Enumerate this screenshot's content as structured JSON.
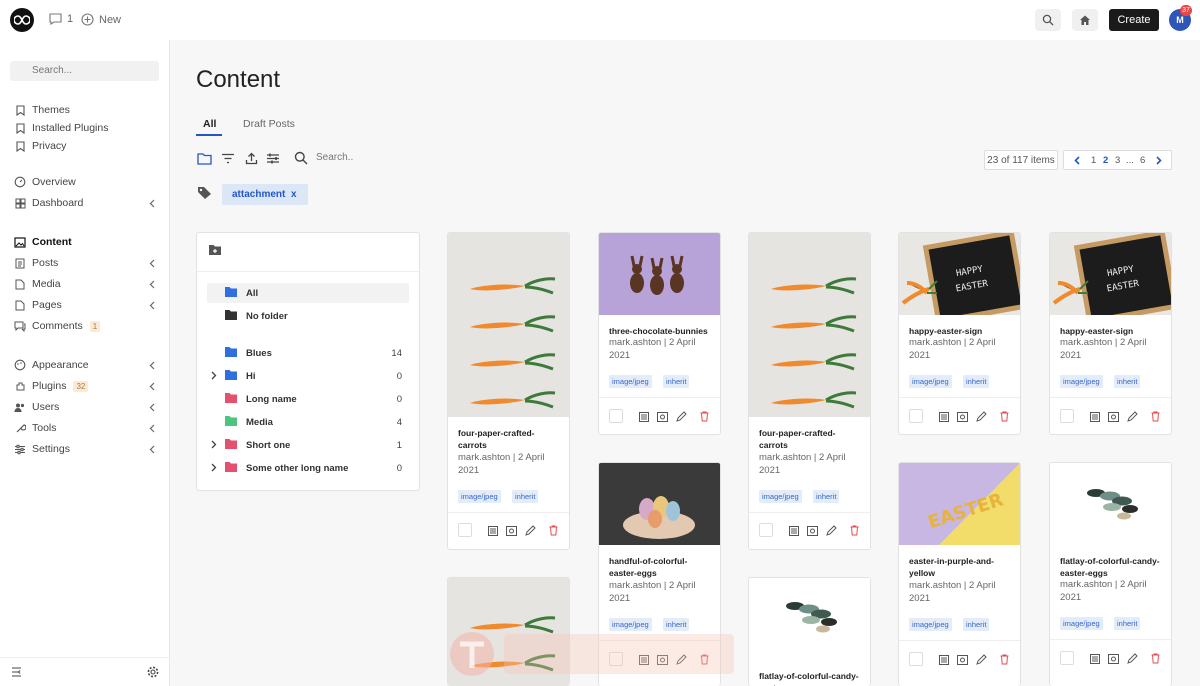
{
  "header": {
    "comments_count": "1",
    "new_label": "New",
    "create_label": "Create",
    "avatar_initial": "M",
    "avatar_badge": "37"
  },
  "sidebar": {
    "search_placeholder": "Search...",
    "items": [
      {
        "label": "Themes"
      },
      {
        "label": "Installed Plugins"
      },
      {
        "label": "Privacy"
      },
      {
        "label": "Overview"
      },
      {
        "label": "Dashboard"
      },
      {
        "label": "Content"
      },
      {
        "label": "Posts"
      },
      {
        "label": "Media"
      },
      {
        "label": "Pages"
      },
      {
        "label": "Comments",
        "badge": "1"
      },
      {
        "label": "Appearance"
      },
      {
        "label": "Plugins",
        "badge": "32"
      },
      {
        "label": "Users"
      },
      {
        "label": "Tools"
      },
      {
        "label": "Settings"
      }
    ]
  },
  "main": {
    "title": "Content",
    "tabs": [
      {
        "label": "All"
      },
      {
        "label": "Draft Posts"
      }
    ],
    "search_placeholder": "Search..",
    "items_count": "23 of 117 items",
    "pagination": [
      "1",
      "2",
      "3",
      "...",
      "6"
    ],
    "filter_tag": "attachment",
    "filter_remove": "x"
  },
  "folders": [
    {
      "name": "All",
      "count": ""
    },
    {
      "name": "No folder",
      "count": ""
    },
    {
      "name": "Blues",
      "count": "14"
    },
    {
      "name": "Hi",
      "count": "0"
    },
    {
      "name": "Long name",
      "count": "0"
    },
    {
      "name": "Media",
      "count": "4"
    },
    {
      "name": "Short one",
      "count": "1"
    },
    {
      "name": "Some other long name",
      "count": "0"
    }
  ],
  "cards": [
    {
      "name": "four-paper-crafted-carrots",
      "meta": "mark.ashton | 2 April 2021",
      "type": "image/jpeg",
      "status": "inherit"
    },
    {
      "name": "three-chocolate-bunnies",
      "meta": "mark.ashton | 2 April 2021",
      "type": "image/jpeg",
      "status": "inherit"
    },
    {
      "name": "four-paper-crafted-carrots",
      "meta": "mark.ashton | 2 April 2021",
      "type": "image/jpeg",
      "status": "inherit"
    },
    {
      "name": "happy-easter-sign",
      "meta": "mark.ashton | 2 April 2021",
      "type": "image/jpeg",
      "status": "inherit"
    },
    {
      "name": "happy-easter-sign",
      "meta": "mark.ashton | 2 April 2021",
      "type": "image/jpeg",
      "status": "inherit"
    },
    {
      "name": "handful-of-colorful-easter-eggs",
      "meta": "mark.ashton | 2 April 2021",
      "type": "image/jpeg",
      "status": "inherit"
    },
    {
      "name": "easter-in-purple-and-yellow",
      "meta": "mark.ashton | 2 April 2021",
      "type": "image/jpeg",
      "status": "inherit"
    },
    {
      "name": "flatlay-of-colorful-candy-easter-eggs",
      "meta": "mark.ashton | 2 April 2021",
      "type": "image/jpeg",
      "status": "inherit"
    },
    {
      "name": "flatlay-of-colorful-candy-easter-eggs",
      "meta": "",
      "type": "",
      "status": ""
    }
  ],
  "colors": {
    "accent": "#2457c5",
    "folder_blue": "#2f6fe0",
    "folder_dark": "#333333",
    "folder_red": "#e5506d",
    "folder_green": "#4cc67f",
    "delete_red": "#e24c4c"
  }
}
